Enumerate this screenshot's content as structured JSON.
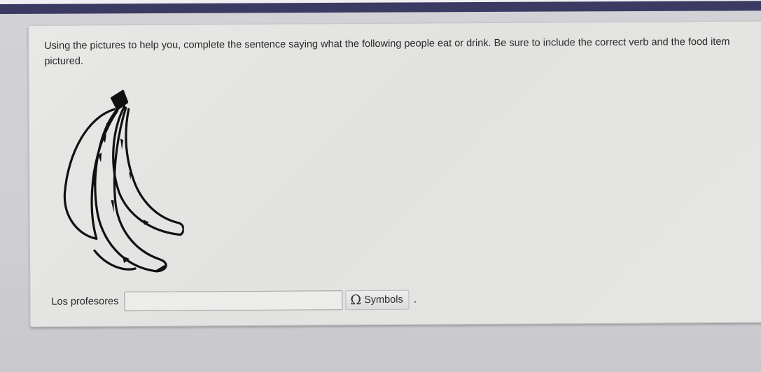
{
  "question": {
    "text": "Using the pictures to help you, complete the sentence saying what the following people eat or drink. Be sure to include the correct verb and the food item pictured."
  },
  "figure": {
    "icon": "bananas-drawing"
  },
  "answer": {
    "label": "Los profesores",
    "value": "",
    "placeholder": "",
    "symbols_label": "Symbols",
    "symbols_icon": "Ω",
    "trailing": "."
  },
  "colors": {
    "top_bar": "#3a3a62",
    "card_bg": "#e6e6e4",
    "page_bg": "#d0d0d4"
  }
}
